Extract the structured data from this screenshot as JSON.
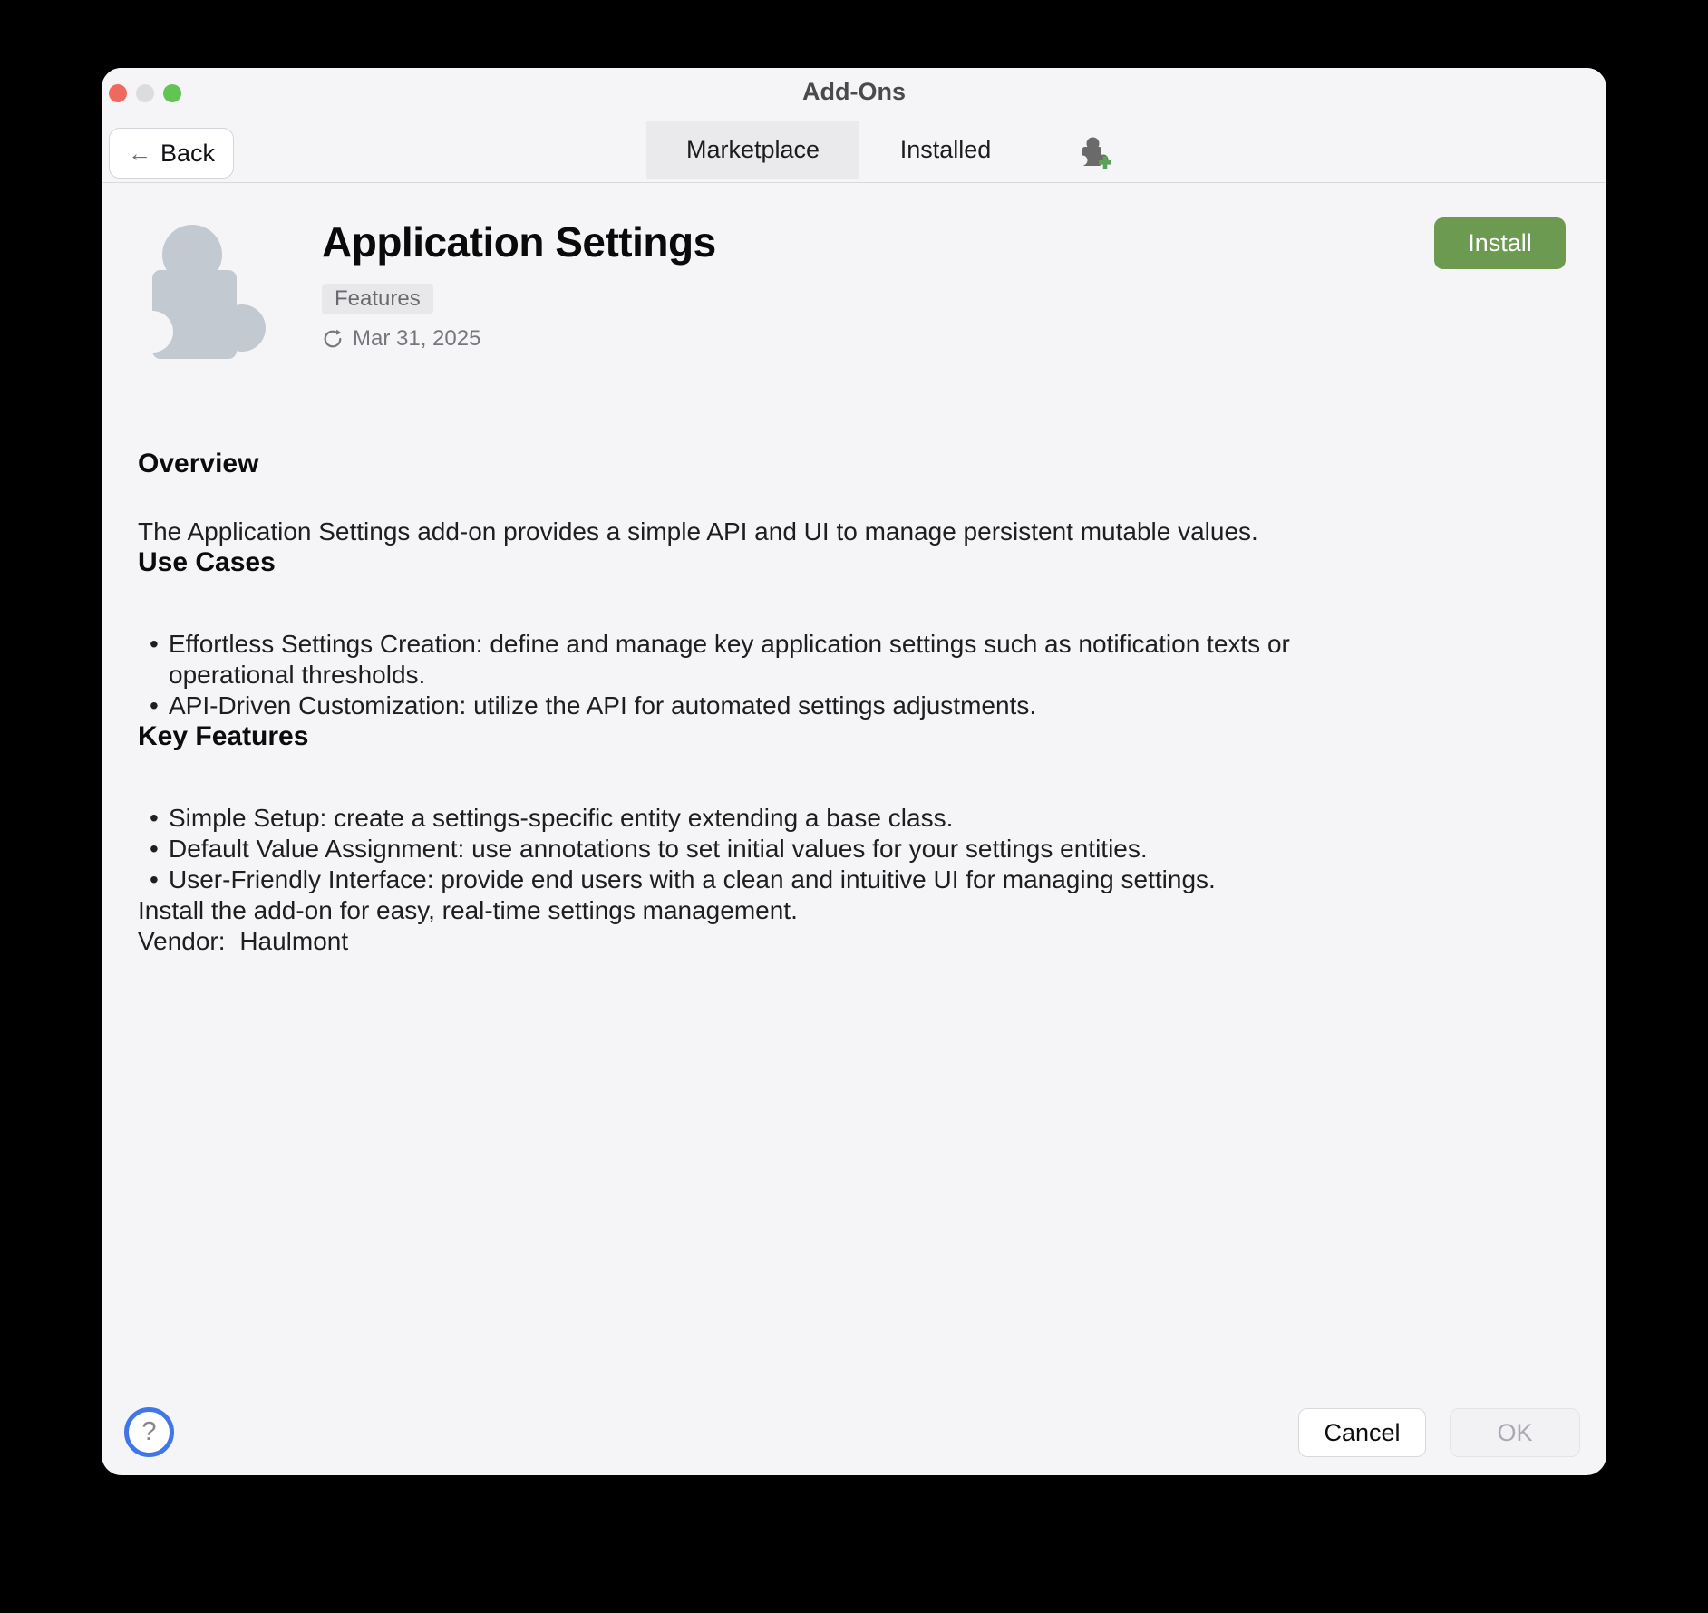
{
  "window": {
    "title": "Add-Ons"
  },
  "toolbar": {
    "back_label": "Back",
    "tabs": [
      {
        "label": "Marketplace",
        "selected": true
      },
      {
        "label": "Installed",
        "selected": false
      }
    ]
  },
  "header": {
    "title": "Application Settings",
    "badge": "Features",
    "updated_date": "Mar 31, 2025",
    "install_label": "Install"
  },
  "sections": {
    "overview": {
      "heading": "Overview",
      "body": "The Application Settings add-on provides a simple API and UI to manage persistent mutable values."
    },
    "use_cases": {
      "heading": "Use Cases",
      "bullets": [
        "Effortless Settings Creation: define and manage key application settings such as notification texts or operational thresholds.",
        "API-Driven Customization: utilize the API for automated settings adjustments."
      ]
    },
    "key_features": {
      "heading": "Key Features",
      "bullets": [
        "Simple Setup: create a settings-specific entity extending a base class.",
        "Default Value Assignment: use annotations to set initial values for your settings entities.",
        "User-Friendly Interface: provide end users with a clean and intuitive UI for managing settings."
      ]
    },
    "install_note": "Install the add-on for easy, real-time settings management.",
    "vendor": {
      "label": "Vendor:",
      "value": "Haulmont"
    }
  },
  "footer": {
    "cancel_label": "Cancel",
    "ok_label": "OK",
    "help_label": "?"
  },
  "colors": {
    "install_green": "#6b9a50",
    "help_ring_blue": "#4176e8",
    "selected_tab_gray": "#eaeaec",
    "window_background": "#f5f5f7"
  },
  "icons": {
    "traffic_lights": [
      "close",
      "minimize",
      "zoom"
    ],
    "puzzle_icon": "add-on puzzle piece",
    "puzzle_add_icon": "install add-on",
    "refresh_icon": "last updated",
    "back_arrow_icon": "back"
  }
}
